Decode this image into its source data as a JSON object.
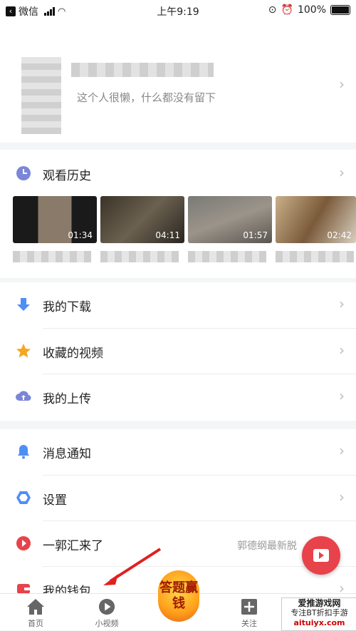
{
  "status": {
    "carrier": "微信",
    "time": "上午9:19",
    "battery": "100%"
  },
  "profile": {
    "bio": "这个人很懒，什么都没有留下"
  },
  "history": {
    "label": "观看历史",
    "videos": [
      {
        "duration": "01:34"
      },
      {
        "duration": "04:11"
      },
      {
        "duration": "01:57"
      },
      {
        "duration": "02:42"
      }
    ]
  },
  "menu1": [
    {
      "label": "我的下载"
    },
    {
      "label": "收藏的视频"
    },
    {
      "label": "我的上传"
    }
  ],
  "menu2": [
    {
      "label": "消息通知"
    },
    {
      "label": "设置"
    },
    {
      "label": "一郭汇来了",
      "extra": "郭德纲最新脱"
    },
    {
      "label": "我的钱包"
    }
  ],
  "nav": {
    "home": "首页",
    "short_video": "小视频",
    "promo": "答题赢钱",
    "follow": "关注"
  },
  "watermark": {
    "line1": "爱推游戏网",
    "line2": "专注BT折扣手游",
    "line3": "aituiyx.com"
  },
  "colors": {
    "accent_red": "#e8424b",
    "icon_blue": "#4f8ef5",
    "icon_star": "#f5a623",
    "icon_purple": "#7b86d8"
  }
}
